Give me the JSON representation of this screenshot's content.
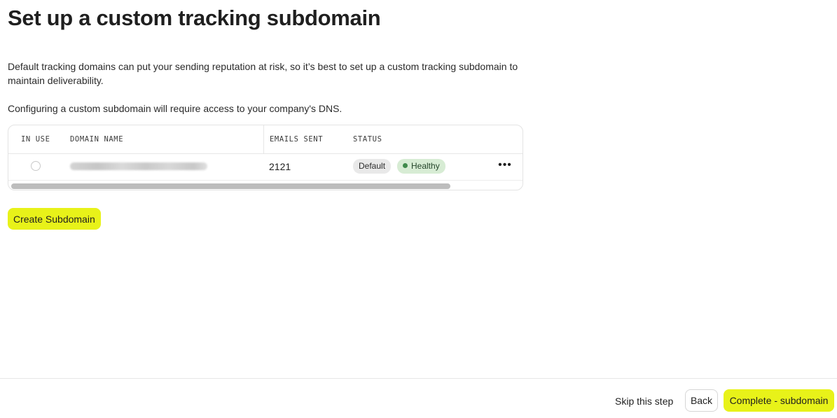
{
  "page": {
    "title": "Set up a custom tracking subdomain",
    "description": "Default tracking domains can put your sending reputation at risk, so it’s best to set up a custom tracking subdomain to maintain deliverability.",
    "dns_note": "Configuring a custom subdomain will require access to your company's DNS."
  },
  "table": {
    "headers": {
      "in_use": "IN USE",
      "domain_name": "DOMAIN NAME",
      "emails_sent": "EMAILS SENT",
      "status": "STATUS"
    },
    "rows": [
      {
        "in_use": false,
        "domain_name_redacted": true,
        "emails_sent": "2121",
        "badges": {
          "default": "Default",
          "healthy": "Healthy"
        },
        "more_icon": "more-horizontal-icon"
      }
    ]
  },
  "actions": {
    "create_subdomain": "Create Subdomain"
  },
  "footer": {
    "skip": "Skip this step",
    "back": "Back",
    "complete": "Complete - subdomain"
  },
  "colors": {
    "accent": "#e8f219",
    "healthy_bg": "#d7ecd4",
    "healthy_dot": "#3f8a4b",
    "default_bg": "#e9e9e9"
  }
}
